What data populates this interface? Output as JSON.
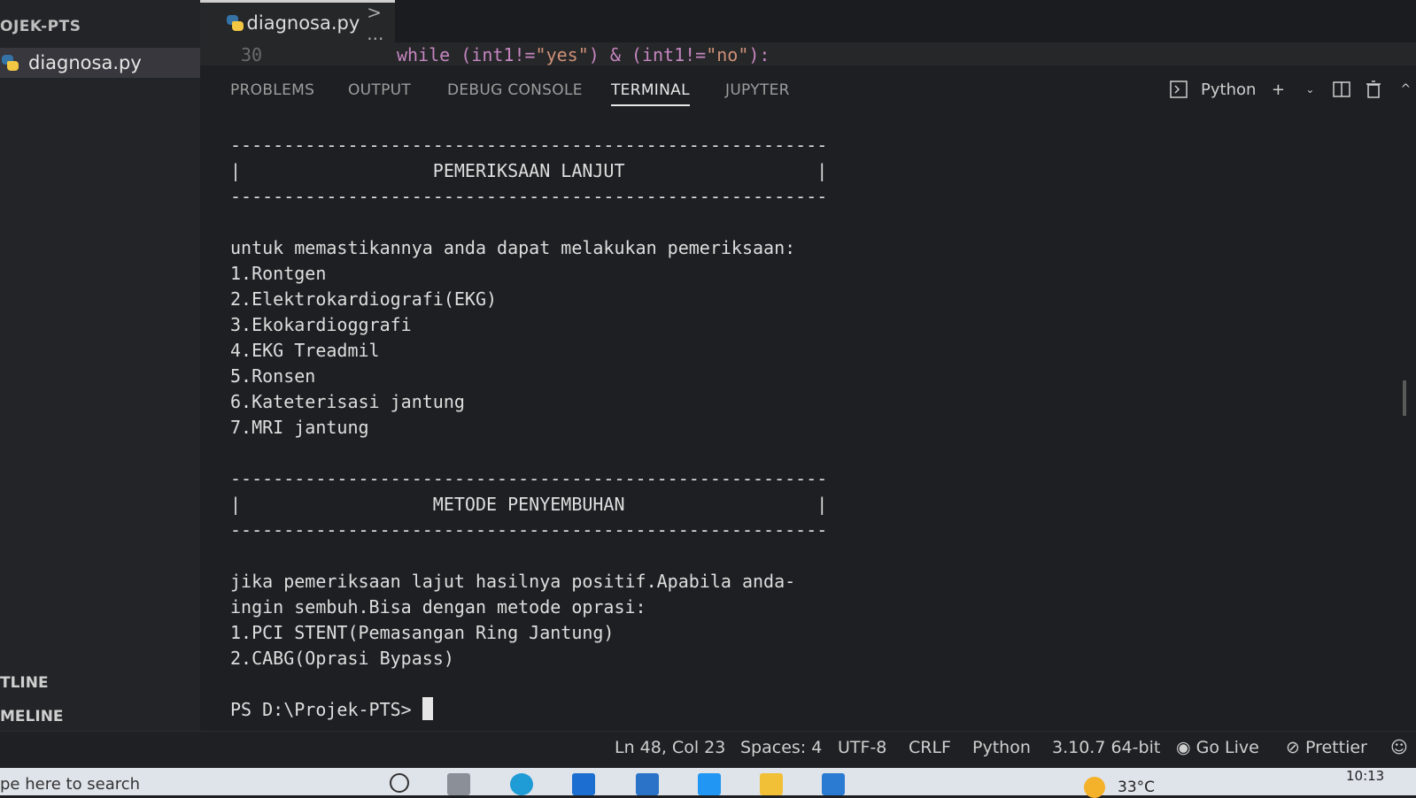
{
  "sidebar": {
    "explorer_title": "OJEK-PTS",
    "file_name": "diagnosa.py",
    "outline": "TLINE",
    "timeline": "MELINE"
  },
  "editor": {
    "tab_name": "diagnosa.py",
    "breadcrumb": "> ...",
    "line_number": "30",
    "code": "while (int1!=\"yes\") & (int1!=\"no\"):"
  },
  "panel": {
    "tabs": [
      "PROBLEMS",
      "OUTPUT",
      "DEBUG CONSOLE",
      "TERMINAL",
      "JUPYTER"
    ],
    "active_tab": "TERMINAL",
    "shell_label": "Python",
    "icons": [
      "terminal-icon",
      "plus-icon",
      "chevron-down-icon",
      "split-icon",
      "trash-icon",
      "chevron-up-icon"
    ]
  },
  "terminal": {
    "lines": [
      "--------------------------------------------------------",
      "|                  PEMERIKSAAN LANJUT                  |",
      "--------------------------------------------------------",
      "",
      "untuk memastikannya anda dapat melakukan pemeriksaan:",
      "1.Rontgen",
      "2.Elektrokardiografi(EKG)",
      "3.Ekokardioggrafi",
      "4.EKG Treadmil",
      "5.Ronsen",
      "6.Kateterisasi jantung",
      "7.MRI jantung",
      "",
      "--------------------------------------------------------",
      "|                  METODE PENYEMBUHAN                  |",
      "--------------------------------------------------------",
      "",
      "jika pemeriksaan lajut hasilnya positif.Apabila anda-",
      "ingin sembuh.Bisa dengan metode oprasi:",
      "1.PCI STENT(Pemasangan Ring Jantung)",
      "2.CABG(Oprasi Bypass)",
      ""
    ],
    "prompt": "PS D:\\Projek-PTS> "
  },
  "statusbar": {
    "position": "Ln 48, Col 23",
    "spaces": "Spaces: 4",
    "encoding": "UTF-8",
    "eol": "CRLF",
    "language": "Python",
    "interpreter": "3.10.7 64-bit",
    "go_live": "Go Live",
    "prettier": "Prettier"
  },
  "taskbar": {
    "search_text": "pe here to search",
    "temperature": "33°C",
    "time": "10:13"
  },
  "colors": {
    "background": "#1e1f22",
    "keyword": "#c586c0",
    "string": "#ce9178",
    "python_blue": "#3572a5",
    "python_yellow": "#f2c744"
  }
}
